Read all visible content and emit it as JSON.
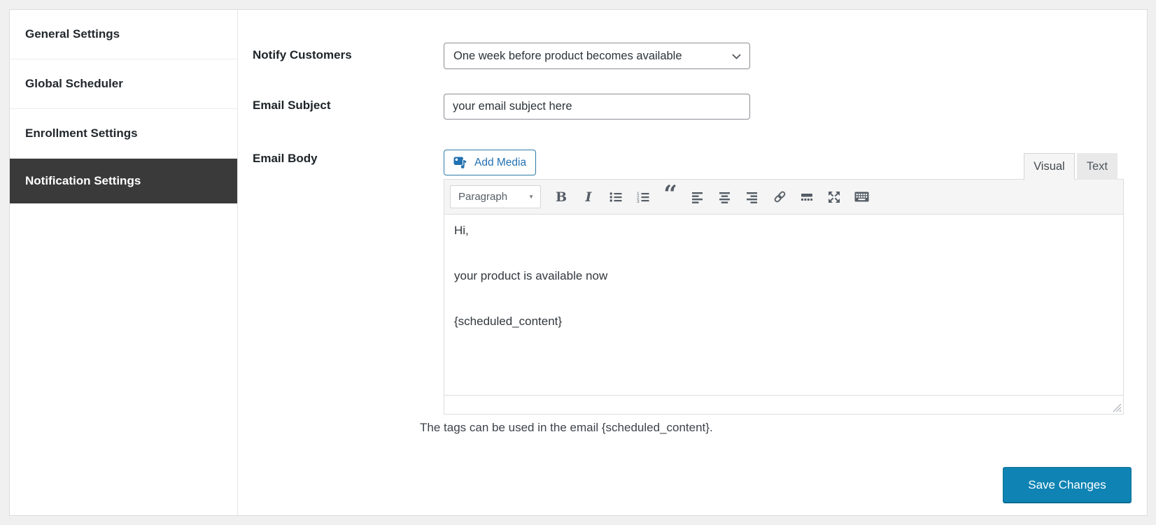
{
  "sidebar": {
    "items": [
      {
        "label": "General Settings",
        "active": false
      },
      {
        "label": "Global Scheduler",
        "active": false
      },
      {
        "label": "Enrollment Settings",
        "active": false
      },
      {
        "label": "Notification Settings",
        "active": true
      }
    ]
  },
  "form": {
    "notify_customers": {
      "label": "Notify Customers",
      "selected_option": "One week before product becomes available"
    },
    "email_subject": {
      "label": "Email Subject",
      "value": "your email subject here"
    },
    "email_body": {
      "label": "Email Body"
    },
    "helper_text": "The tags can be used in the email {scheduled_content}.",
    "save_button": "Save Changes"
  },
  "editor": {
    "add_media_label": "Add Media",
    "tabs": {
      "visual": "Visual",
      "text": "Text"
    },
    "toolbar": {
      "paragraph_label": "Paragraph",
      "caret_glyph": "▼",
      "bold_glyph": "B",
      "italic_glyph": "I",
      "blockquote_glyph": "“",
      "icon_names": [
        "media-icon",
        "chevron-down-icon",
        "paragraph-dropdown",
        "bold",
        "italic",
        "bulleted-list",
        "numbered-list",
        "blockquote",
        "align-left",
        "align-center",
        "align-right",
        "insert-link",
        "read-more",
        "fullscreen",
        "toolbar-toggle",
        "resize-grip"
      ]
    },
    "content": {
      "lines": [
        "Hi,",
        "your product is available now",
        "{scheduled_content}"
      ]
    }
  },
  "colors": {
    "accent_blue": "#2271b1",
    "primary_button": "#0f84b4",
    "active_tab_bg": "#3a3a3a",
    "page_bg": "#f0f0f1"
  }
}
